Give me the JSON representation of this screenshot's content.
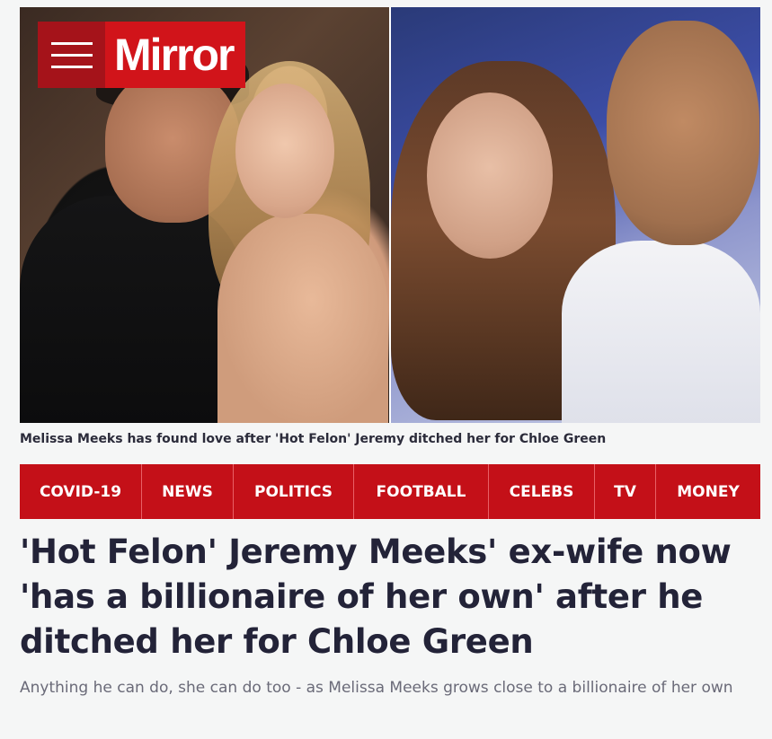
{
  "brand": {
    "name": "Mirror",
    "accent": "#d1141a",
    "accent_dark": "#a5131a",
    "menu_icon": "hamburger-menu-icon"
  },
  "hero": {
    "caption": "Melissa Meeks has found love after 'Hot Felon' Jeremy ditched her for Chloe Green"
  },
  "nav": {
    "items": [
      {
        "label": "COVID-19"
      },
      {
        "label": "NEWS"
      },
      {
        "label": "POLITICS"
      },
      {
        "label": "FOOTBALL"
      },
      {
        "label": "CELEBS"
      },
      {
        "label": "TV"
      },
      {
        "label": "MONEY"
      }
    ]
  },
  "article": {
    "headline": "'Hot Felon' Jeremy Meeks' ex-wife now 'has a billionaire of her own' after he ditched her for Chloe Green",
    "standfirst": "Anything he can do, she can do too - as Melissa Meeks grows close to a billionaire of her own"
  }
}
